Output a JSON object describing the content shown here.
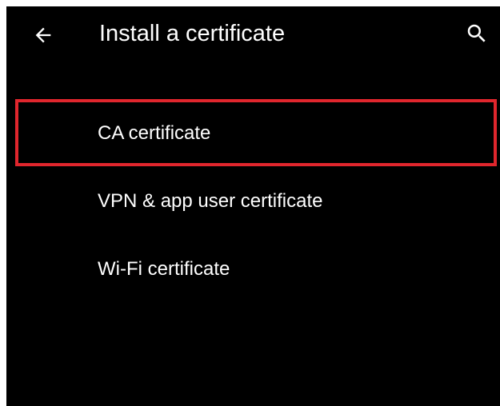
{
  "app_bar": {
    "title": "Install a certificate",
    "back_icon": "arrow-back-icon",
    "search_icon": "search-icon"
  },
  "options": [
    {
      "label": "CA certificate",
      "highlighted": true
    },
    {
      "label": "VPN & app user certificate",
      "highlighted": false
    },
    {
      "label": "Wi-Fi certificate",
      "highlighted": false
    }
  ],
  "colors": {
    "background": "#000000",
    "text": "#ffffff",
    "highlight_border": "#e0262d"
  }
}
